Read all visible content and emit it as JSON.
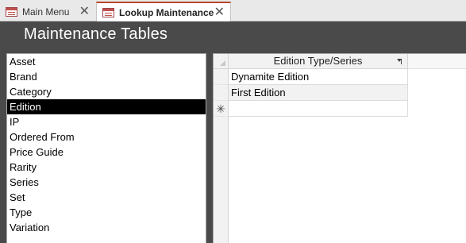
{
  "tabs": [
    {
      "label": "Main Menu",
      "active": false
    },
    {
      "label": "Lookup Maintenance",
      "active": true
    }
  ],
  "icons": {
    "tab_icon": "form-icon",
    "close": "close-icon",
    "new_record": "new-record-icon",
    "sort": "sort-filter-icon"
  },
  "colors": {
    "header_bg": "#4a4a4a",
    "selected_bg": "#000000",
    "active_tab_accent": "#b7472a"
  },
  "header": {
    "title": "Maintenance Tables"
  },
  "tables_list": {
    "selected": "Edition",
    "items": [
      "Asset",
      "Brand",
      "Category",
      "Edition",
      "IP",
      "Ordered From",
      "Price Guide",
      "Rarity",
      "Series",
      "Set",
      "Type",
      "Variation"
    ]
  },
  "datasheet": {
    "column_header": "Edition Type/Series",
    "rows": [
      "Dynamite Edition",
      "First Edition"
    ],
    "new_record_marker": "✳"
  }
}
